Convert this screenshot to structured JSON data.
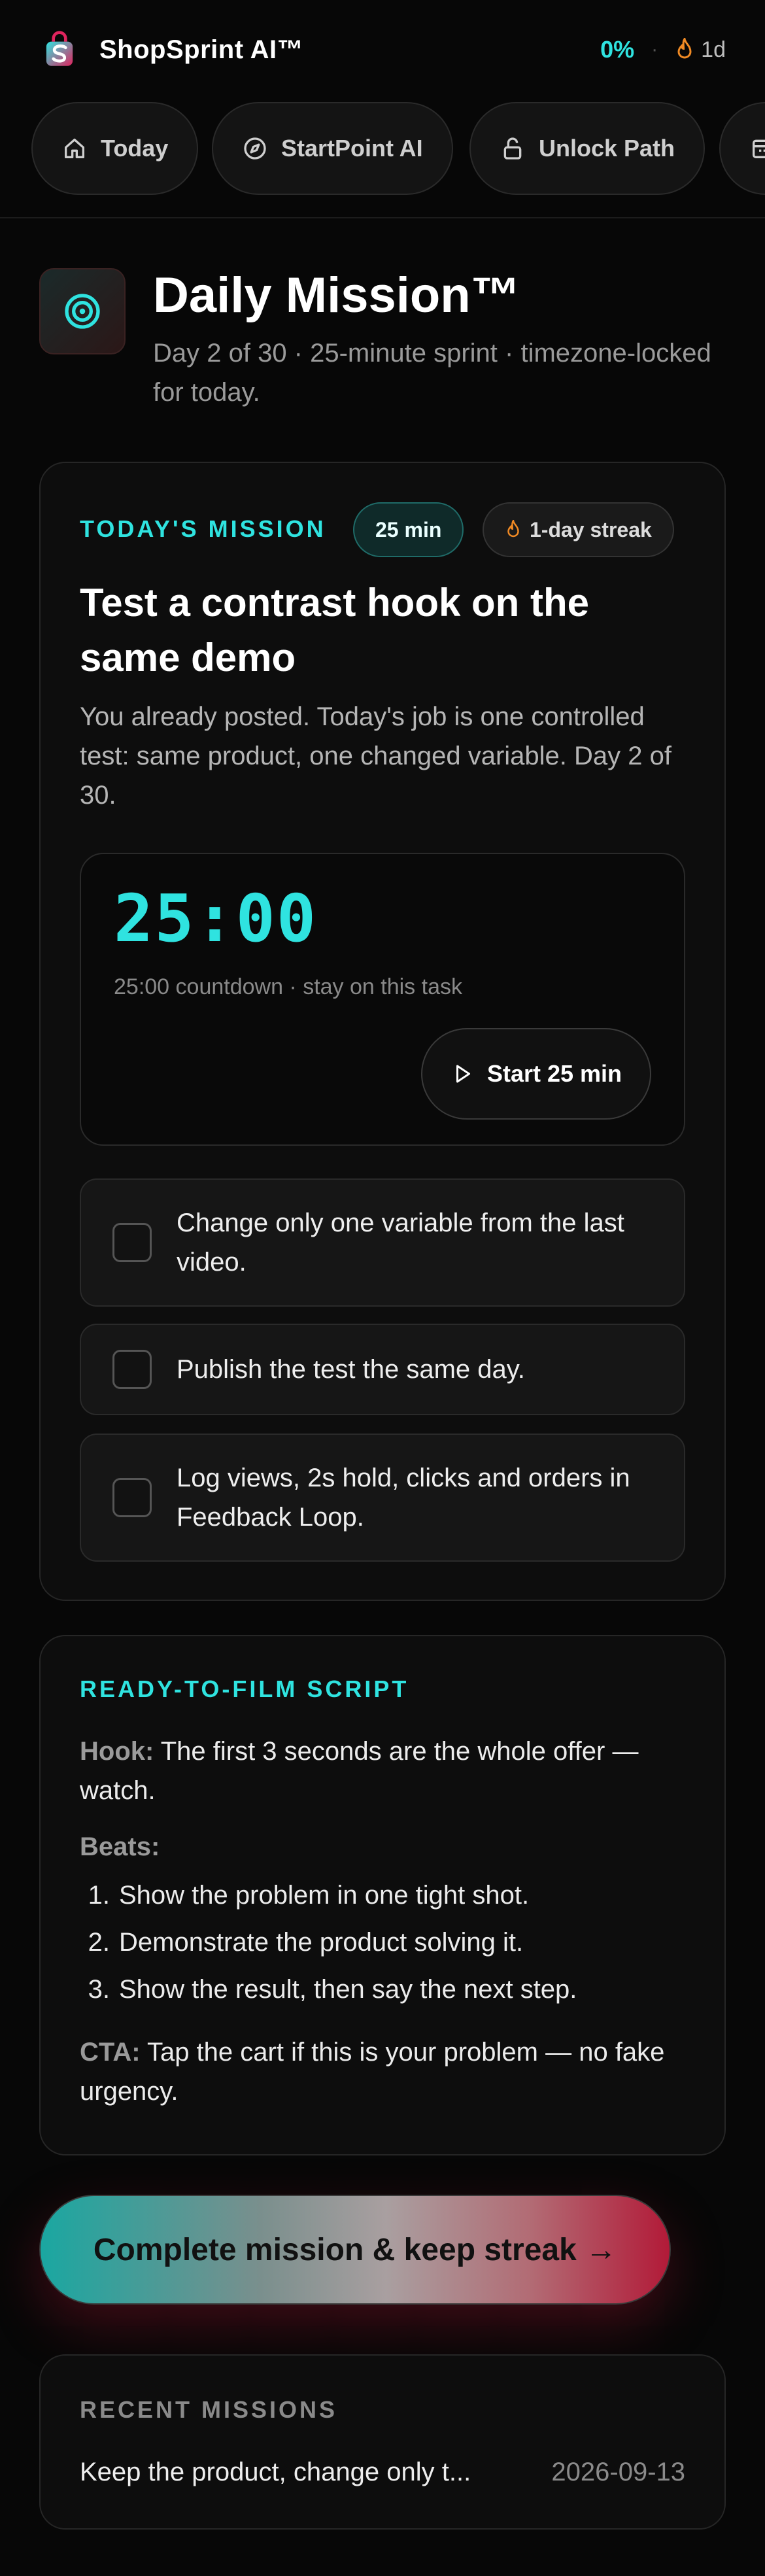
{
  "header": {
    "brand": "ShopSprint AI™",
    "progress": "0%",
    "separator": "·",
    "streak": "1d"
  },
  "nav": {
    "items": [
      {
        "label": "Today",
        "icon": "home-icon"
      },
      {
        "label": "StartPoint AI",
        "icon": "compass-icon"
      },
      {
        "label": "Unlock Path",
        "icon": "unlock-icon"
      },
      {
        "label": "",
        "icon": "calendar-icon"
      }
    ]
  },
  "page": {
    "title": "Daily Mission™",
    "subtitle": "Day 2 of 30 · 25-minute sprint · timezone-locked for today."
  },
  "mission": {
    "eyebrow": "TODAY'S MISSION",
    "time_badge": "25 min",
    "streak_badge": "1-day streak",
    "title": "Test a contrast hook on the same demo",
    "description": "You already posted. Today's job is one controlled test: same product, one changed variable. Day 2 of 30.",
    "timer": "25:00",
    "timer_note": "25:00 countdown · stay on this task",
    "start_label": "Start 25 min",
    "checklist": [
      {
        "label": "Change only one variable from the last video.",
        "checked": false
      },
      {
        "label": "Publish the test the same day.",
        "checked": false
      },
      {
        "label": "Log views, 2s hold, clicks and orders in Feedback Loop.",
        "checked": false
      }
    ]
  },
  "script": {
    "eyebrow": "READY-TO-FILM SCRIPT",
    "hook_key": "Hook:",
    "hook": "The first 3 seconds are the whole offer — watch.",
    "beats_label": "Beats:",
    "beats": [
      "Show the problem in one tight shot.",
      "Demonstrate the product solving it.",
      "Show the result, then say the next step."
    ],
    "cta_key": "CTA:",
    "cta": "Tap the cart if this is your problem — no fake urgency."
  },
  "complete_button": "Complete mission & keep streak →",
  "recent": {
    "title": "RECENT MISSIONS",
    "items": [
      {
        "text": "Keep the product, change only t...",
        "date": "2026-09-13"
      }
    ]
  },
  "colors": {
    "accent": "#2fe3e0",
    "background": "#070707",
    "cta_gradient_start": "#1aa7a1",
    "cta_gradient_end": "#b21a38"
  }
}
